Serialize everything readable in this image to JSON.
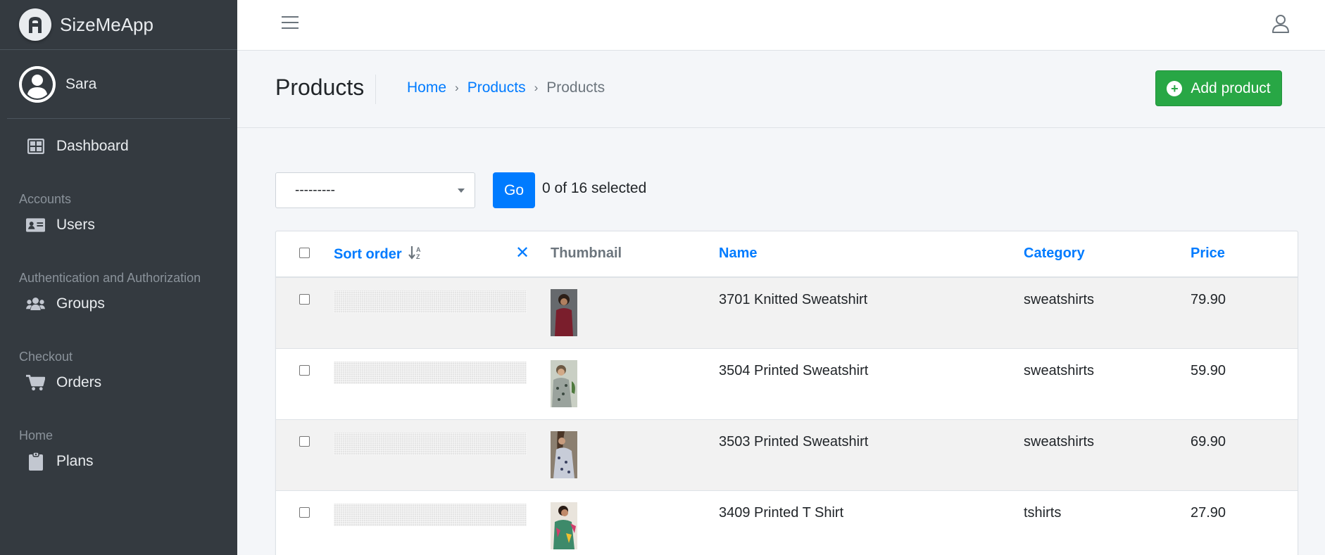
{
  "app": {
    "brand": "SizeMeApp",
    "user": "Sara"
  },
  "sidebar": {
    "dashboard": "Dashboard",
    "sections": [
      {
        "header": "Accounts",
        "item": "Users"
      },
      {
        "header": "Authentication and Authorization",
        "item": "Groups"
      },
      {
        "header": "Checkout",
        "item": "Orders"
      },
      {
        "header": "Home",
        "item": "Plans"
      }
    ]
  },
  "page": {
    "title": "Products",
    "breadcrumb": [
      "Home",
      "Products",
      "Products"
    ],
    "add_button": "Add product"
  },
  "actions": {
    "select_value": "---------",
    "go_label": "Go",
    "selected_text": "0 of 16 selected"
  },
  "table": {
    "columns": [
      "Sort order",
      "Thumbnail",
      "Name",
      "Category",
      "Price"
    ],
    "rows": [
      {
        "name": "3701 Knitted Sweatshirt",
        "category": "sweatshirts",
        "price": "79.90"
      },
      {
        "name": "3504 Printed Sweatshirt",
        "category": "sweatshirts",
        "price": "59.90"
      },
      {
        "name": "3503 Printed Sweatshirt",
        "category": "sweatshirts",
        "price": "69.90"
      },
      {
        "name": "3409 Printed T Shirt",
        "category": "tshirts",
        "price": "27.90"
      }
    ]
  },
  "colors": {
    "sidebar": "#343a40",
    "primary": "#007bff",
    "success": "#28a745"
  }
}
